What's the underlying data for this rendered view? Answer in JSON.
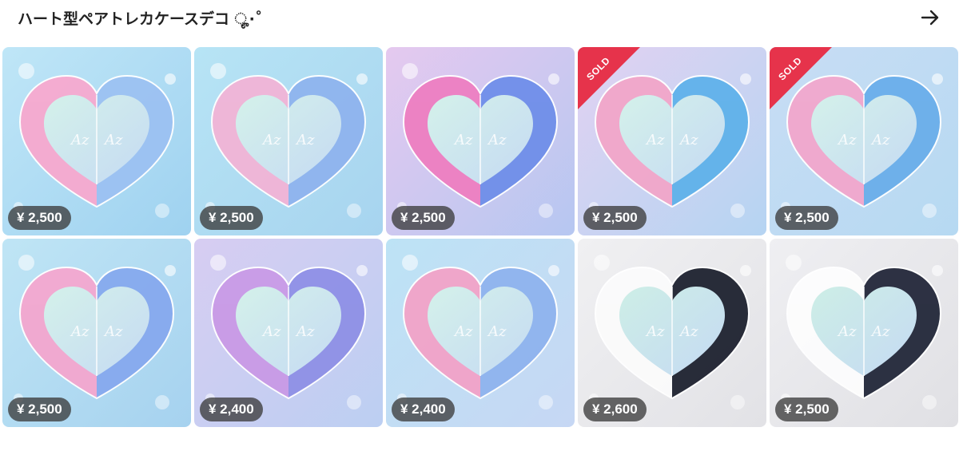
{
  "header": {
    "title": "ハート型ペアトレカケースデコ ೄ·˚",
    "arrow_icon": "arrow-right-icon"
  },
  "colors": {
    "sold_red": "#e6334b",
    "price_pill": "#3c3c3c",
    "title_text": "#222222"
  },
  "products": [
    {
      "price": "¥ 2,500",
      "sold": false,
      "theme": "pastel",
      "bg": [
        "#bfe6f7",
        "#9fd2f0"
      ],
      "frame": [
        "#f7a9cf",
        "#9cc1f2"
      ],
      "inner": [
        "#d4f1ea",
        "#c5daf3"
      ]
    },
    {
      "price": "¥ 2,500",
      "sold": false,
      "theme": "pastel",
      "bg": [
        "#b7e4f5",
        "#a7d4ef"
      ],
      "frame": [
        "#f2b4d6",
        "#8fb4ee"
      ],
      "inner": [
        "#d4f1ea",
        "#c5daf3"
      ]
    },
    {
      "price": "¥ 2,500",
      "sold": false,
      "theme": "pastel",
      "bg": [
        "#e5c9ef",
        "#b6c7f1"
      ],
      "frame": [
        "#ee7fc1",
        "#6f8fe9"
      ],
      "inner": [
        "#d4f1ea",
        "#c5daf3"
      ]
    },
    {
      "price": "¥ 2,500",
      "sold": true,
      "sold_label": "SOLD",
      "theme": "pastel",
      "bg": [
        "#e2d2f2",
        "#b5d4f2"
      ],
      "frame": [
        "#f2a6c9",
        "#5fb2ea"
      ],
      "inner": [
        "#d4f1ea",
        "#c5daf3"
      ]
    },
    {
      "price": "¥ 2,500",
      "sold": true,
      "sold_label": "SOLD",
      "theme": "pastel",
      "bg": [
        "#c8ddf4",
        "#b6d9f2"
      ],
      "frame": [
        "#f2a7cd",
        "#6aaeea"
      ],
      "inner": [
        "#d4f1ea",
        "#c5daf3"
      ]
    },
    {
      "price": "¥ 2,500",
      "sold": false,
      "theme": "pastel",
      "bg": [
        "#bfe5f5",
        "#a6d2ef"
      ],
      "frame": [
        "#f4a7cf",
        "#86a9ee"
      ],
      "inner": [
        "#d4f1ea",
        "#c5daf3"
      ]
    },
    {
      "price": "¥ 2,400",
      "sold": false,
      "theme": "pastel",
      "bg": [
        "#d7cdf2",
        "#bccff2"
      ],
      "frame": [
        "#c99ae6",
        "#8f90e6"
      ],
      "inner": [
        "#d4f1ea",
        "#c5daf3"
      ]
    },
    {
      "price": "¥ 2,400",
      "sold": false,
      "theme": "pastel",
      "bg": [
        "#bde3f5",
        "#c6d7f4"
      ],
      "frame": [
        "#f2a3c8",
        "#8fb3ee"
      ],
      "inner": [
        "#d4f1ea",
        "#c5daf3"
      ]
    },
    {
      "price": "¥ 2,600",
      "sold": false,
      "theme": "mono",
      "bg": [
        "#f0f0f2",
        "#e2e2e6"
      ],
      "frame": [
        "#fbfbfb",
        "#1e2230"
      ],
      "inner": [
        "#cdeee6",
        "#c5daf3"
      ]
    },
    {
      "price": "¥ 2,500",
      "sold": false,
      "theme": "mono",
      "bg": [
        "#efeff2",
        "#e0e0e4"
      ],
      "frame": [
        "#fdfdfd",
        "#23283a"
      ],
      "inner": [
        "#cdeee6",
        "#c5daf3"
      ]
    }
  ]
}
